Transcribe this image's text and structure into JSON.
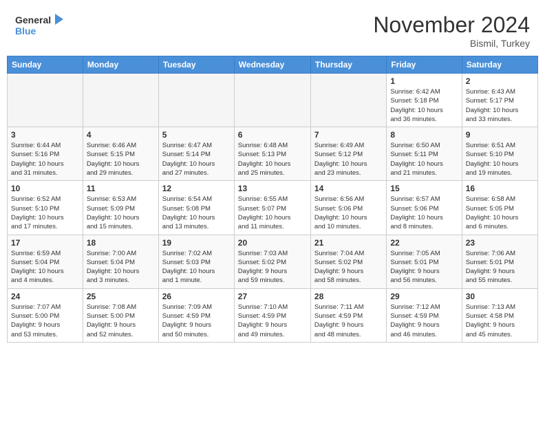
{
  "header": {
    "logo_line1": "General",
    "logo_line2": "Blue",
    "month": "November 2024",
    "location": "Bismil, Turkey"
  },
  "weekdays": [
    "Sunday",
    "Monday",
    "Tuesday",
    "Wednesday",
    "Thursday",
    "Friday",
    "Saturday"
  ],
  "weeks": [
    [
      {
        "day": "",
        "info": ""
      },
      {
        "day": "",
        "info": ""
      },
      {
        "day": "",
        "info": ""
      },
      {
        "day": "",
        "info": ""
      },
      {
        "day": "",
        "info": ""
      },
      {
        "day": "1",
        "info": "Sunrise: 6:42 AM\nSunset: 5:18 PM\nDaylight: 10 hours\nand 36 minutes."
      },
      {
        "day": "2",
        "info": "Sunrise: 6:43 AM\nSunset: 5:17 PM\nDaylight: 10 hours\nand 33 minutes."
      }
    ],
    [
      {
        "day": "3",
        "info": "Sunrise: 6:44 AM\nSunset: 5:16 PM\nDaylight: 10 hours\nand 31 minutes."
      },
      {
        "day": "4",
        "info": "Sunrise: 6:46 AM\nSunset: 5:15 PM\nDaylight: 10 hours\nand 29 minutes."
      },
      {
        "day": "5",
        "info": "Sunrise: 6:47 AM\nSunset: 5:14 PM\nDaylight: 10 hours\nand 27 minutes."
      },
      {
        "day": "6",
        "info": "Sunrise: 6:48 AM\nSunset: 5:13 PM\nDaylight: 10 hours\nand 25 minutes."
      },
      {
        "day": "7",
        "info": "Sunrise: 6:49 AM\nSunset: 5:12 PM\nDaylight: 10 hours\nand 23 minutes."
      },
      {
        "day": "8",
        "info": "Sunrise: 6:50 AM\nSunset: 5:11 PM\nDaylight: 10 hours\nand 21 minutes."
      },
      {
        "day": "9",
        "info": "Sunrise: 6:51 AM\nSunset: 5:10 PM\nDaylight: 10 hours\nand 19 minutes."
      }
    ],
    [
      {
        "day": "10",
        "info": "Sunrise: 6:52 AM\nSunset: 5:10 PM\nDaylight: 10 hours\nand 17 minutes."
      },
      {
        "day": "11",
        "info": "Sunrise: 6:53 AM\nSunset: 5:09 PM\nDaylight: 10 hours\nand 15 minutes."
      },
      {
        "day": "12",
        "info": "Sunrise: 6:54 AM\nSunset: 5:08 PM\nDaylight: 10 hours\nand 13 minutes."
      },
      {
        "day": "13",
        "info": "Sunrise: 6:55 AM\nSunset: 5:07 PM\nDaylight: 10 hours\nand 11 minutes."
      },
      {
        "day": "14",
        "info": "Sunrise: 6:56 AM\nSunset: 5:06 PM\nDaylight: 10 hours\nand 10 minutes."
      },
      {
        "day": "15",
        "info": "Sunrise: 6:57 AM\nSunset: 5:06 PM\nDaylight: 10 hours\nand 8 minutes."
      },
      {
        "day": "16",
        "info": "Sunrise: 6:58 AM\nSunset: 5:05 PM\nDaylight: 10 hours\nand 6 minutes."
      }
    ],
    [
      {
        "day": "17",
        "info": "Sunrise: 6:59 AM\nSunset: 5:04 PM\nDaylight: 10 hours\nand 4 minutes."
      },
      {
        "day": "18",
        "info": "Sunrise: 7:00 AM\nSunset: 5:04 PM\nDaylight: 10 hours\nand 3 minutes."
      },
      {
        "day": "19",
        "info": "Sunrise: 7:02 AM\nSunset: 5:03 PM\nDaylight: 10 hours\nand 1 minute."
      },
      {
        "day": "20",
        "info": "Sunrise: 7:03 AM\nSunset: 5:02 PM\nDaylight: 9 hours\nand 59 minutes."
      },
      {
        "day": "21",
        "info": "Sunrise: 7:04 AM\nSunset: 5:02 PM\nDaylight: 9 hours\nand 58 minutes."
      },
      {
        "day": "22",
        "info": "Sunrise: 7:05 AM\nSunset: 5:01 PM\nDaylight: 9 hours\nand 56 minutes."
      },
      {
        "day": "23",
        "info": "Sunrise: 7:06 AM\nSunset: 5:01 PM\nDaylight: 9 hours\nand 55 minutes."
      }
    ],
    [
      {
        "day": "24",
        "info": "Sunrise: 7:07 AM\nSunset: 5:00 PM\nDaylight: 9 hours\nand 53 minutes."
      },
      {
        "day": "25",
        "info": "Sunrise: 7:08 AM\nSunset: 5:00 PM\nDaylight: 9 hours\nand 52 minutes."
      },
      {
        "day": "26",
        "info": "Sunrise: 7:09 AM\nSunset: 4:59 PM\nDaylight: 9 hours\nand 50 minutes."
      },
      {
        "day": "27",
        "info": "Sunrise: 7:10 AM\nSunset: 4:59 PM\nDaylight: 9 hours\nand 49 minutes."
      },
      {
        "day": "28",
        "info": "Sunrise: 7:11 AM\nSunset: 4:59 PM\nDaylight: 9 hours\nand 48 minutes."
      },
      {
        "day": "29",
        "info": "Sunrise: 7:12 AM\nSunset: 4:59 PM\nDaylight: 9 hours\nand 46 minutes."
      },
      {
        "day": "30",
        "info": "Sunrise: 7:13 AM\nSunset: 4:58 PM\nDaylight: 9 hours\nand 45 minutes."
      }
    ]
  ]
}
